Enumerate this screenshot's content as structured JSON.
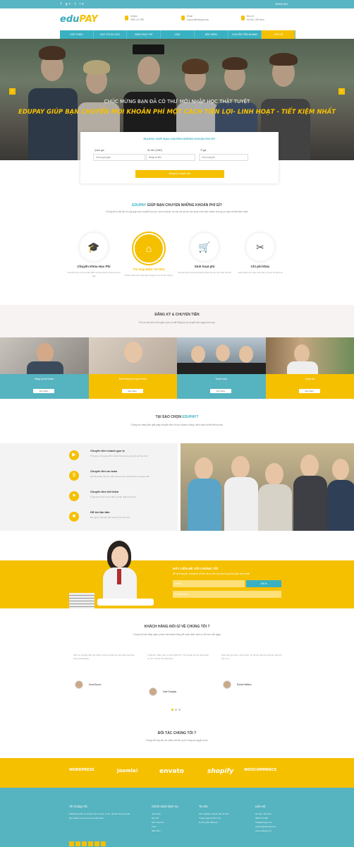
{
  "topbar": {
    "social": "f  g+  t  in",
    "lang": "ENGLISH"
  },
  "header": {
    "logo_main": "edu",
    "logo_accent": "PAY",
    "info": [
      {
        "line1": "Hotline",
        "line2": "0900 111 999"
      },
      {
        "line1": "Email",
        "line2": "support@edupay.com"
      },
      {
        "line1": "Địa chỉ",
        "line2": "Hà Nội, Việt Nam"
      }
    ]
  },
  "nav": {
    "items": [
      "GIỚI THIỆU",
      "HỌC PHÍ DU HỌC",
      "SINH HOẠT PHÍ",
      "VISA",
      "BẢO HIỂM",
      "CHUYỂN TIỀN NHANH",
      "LIÊN HỆ"
    ]
  },
  "hero": {
    "subtitle": "CHÚC MỪNG BẠN ĐÃ CÓ THƯ MỜI NHẬP HỌC THẬT TUYỆT",
    "title": "EDUPAY GIÚP BẠN CHUYỂN MỌI KHOẢN PHÍ MỘT CÁCH TIỆN LỢI- LINH HOẠT - TIẾT KIỆM NHẤT",
    "prev": "‹",
    "next": "›"
  },
  "calculator": {
    "title": "EDUPAY GIÚP BẠN CHUYỂN NHỮNG KHOẢN PHÍ GÌ?",
    "fields": [
      {
        "label": "Quốc gia",
        "value": "Chọn quốc gia"
      },
      {
        "label": "Số tiền (VNĐ)",
        "value": "Nhập số tiền"
      },
      {
        "label": "Tỉ giá",
        "value": "Chọn loại phí"
      }
    ],
    "button": "Đăng ký chuyển tiền"
  },
  "services": {
    "title_accent": "EDUPAY",
    "title": "GIÚP BẠN CHUYỂN NHỮNG KHOẢN PHÍ GÌ?",
    "desc": "Chúng tôi là đối tác tin cậy giúp bạn chuyển học phí, sinh hoạt phí và các chi phí du học khác một cách nhanh chóng, an toàn và tiết kiệm nhất.",
    "items": [
      {
        "title": "Chuyển Khóa Học Phí",
        "desc": "Chuyển học phí trực tiếp đến trường nhanh chóng và an toàn",
        "icon": "graduation-cap-icon",
        "glyph": "🎓"
      },
      {
        "title": "Trả Góp Điện Tử Nhà",
        "desc": "Thanh toán linh hoạt theo từng kỳ với chi phí hợp lý",
        "icon": "home-icon",
        "glyph": "⌂"
      },
      {
        "title": "Sinh hoạt phí",
        "desc": "Chuyển sinh hoạt phí hàng tháng cho du học sinh tiện lợi",
        "icon": "cart-icon",
        "glyph": "🛒"
      },
      {
        "title": "Chi phí khác",
        "desc": "Các khoản phí visa, bảo hiểm, lệ phí thi quốc tế",
        "icon": "tools-icon",
        "glyph": "✂"
      }
    ]
  },
  "register": {
    "title": "ĐĂNG KÝ & CHUYỂN TIỀN",
    "desc": "Chỉ với vài bước đơn giản, bạn có thể đăng ký và chuyển tiền ngay hôm nay.",
    "cards": [
      {
        "label": "Đăng ký tài khoản",
        "button": "Xem thêm"
      },
      {
        "label": "Điền thông tin người nhận",
        "button": "Xem thêm"
      },
      {
        "label": "Thanh toán",
        "button": "Xem thêm"
      },
      {
        "label": "Hoàn tất",
        "button": "Xem thêm"
      }
    ]
  },
  "why": {
    "title_prefix": "TẠI SAO CHỌN",
    "title_accent": "EDUPAY?",
    "desc": "Chúng tôi mang đến giải pháp chuyển tiền du học nhanh chóng, minh bạch và tiết kiệm nhất.",
    "items": [
      {
        "title": "Chuyển tiền nhanh gọn lẹ",
        "desc": "Thời gian xử lý giao dịch nhanh chóng trong vòng 24 giờ làm việc.",
        "icon": "truck-icon",
        "glyph": "▶"
      },
      {
        "title": "Chuyển tiền an toàn",
        "desc": "Hệ thống bảo mật cao, đảm bảo an toàn tuyệt đối cho mọi giao dịch.",
        "icon": "coins-icon",
        "glyph": "$"
      },
      {
        "title": "Chuyển tiền tiết kiệm",
        "desc": "Tỉ giá cạnh tranh và phí dịch vụ thấp nhất thị trường.",
        "icon": "piggy-bank-icon",
        "glyph": "♥"
      },
      {
        "title": "Hỗ trợ tận tâm",
        "desc": "Đội ngũ tư vấn luôn sẵn sàng hỗ trợ bạn 24/7.",
        "icon": "lock-icon",
        "glyph": "■"
      }
    ]
  },
  "contact": {
    "title": "HÃY LIÊN HỆ VỚI CHÚNG TÔI",
    "desc": "Để lại thông tin, chúng tôi sẽ liên hệ tư vấn cho bạn trong thời gian sớm nhất.",
    "email_placeholder": "Email",
    "phone_placeholder": "Số điện thoại",
    "submit": "Gửi đi"
  },
  "testimonials": {
    "title": "KHÁCH HÀNG NÓI GÌ VỀ CHÚNG TÔI ?",
    "desc": "Chúng tôi luôn lắng nghe ý kiến của khách hàng để hoàn thiện dịch vụ tốt hơn mỗi ngày.",
    "items": [
      {
        "quote": "Dịch vụ chuyển tiền rất nhanh chóng và tiện lợi, tôi hoàn toàn hài lòng với EduPay.",
        "name": "Anna Brown"
      },
      {
        "quote": "Tỉ giá tốt, nhân viên tư vấn nhiệt tình. Tôi sẽ tiếp tục sử dụng dịch vụ cho các kỳ học tiếp theo.",
        "name": "Kate Douglas"
      },
      {
        "quote": "Giao dịch an toàn, minh bạch, tôi rất yên tâm khi chuyển học phí cho con.",
        "name": "Robert Wilkins"
      }
    ]
  },
  "partners": {
    "title": "ĐỐI TÁC CHÚNG TÔI ?",
    "desc": "Chúng tôi hợp tác với nhiều đối tác uy tín trong và ngoài nước.",
    "logos": [
      "WORDPRESS",
      "Joomla!",
      "envato",
      "shopify",
      "WOOCOMMERCE"
    ]
  },
  "footer": {
    "about_title": "Về Chúng Tôi",
    "about_text": "EduPay là dịch vụ chuyển tiền du học uy tín, nhanh chóng và tiết kiệm dành cho du học sinh Việt Nam.",
    "links_title": "Chính Sách Dịch Vụ",
    "links": [
      "Giới thiệu",
      "Học phí",
      "Sinh hoạt phí",
      "Visa",
      "Bảo hiểm"
    ],
    "news_title": "Tin tức",
    "news": [
      "Kinh nghiệm chuyển tiền du học",
      "Tỉ giá ngoại tệ hôm nay",
      "Hướng dẫn đăng ký"
    ],
    "contact_title": "Liên Hệ",
    "contact_lines": [
      "Hà Nội, Việt Nam",
      "0900 111 999",
      "info@edupay.com",
      "support@edupay.com",
      "www.edupay.com"
    ]
  },
  "colors": {
    "primary": "#3ab1c2",
    "accent": "#f5c000"
  }
}
